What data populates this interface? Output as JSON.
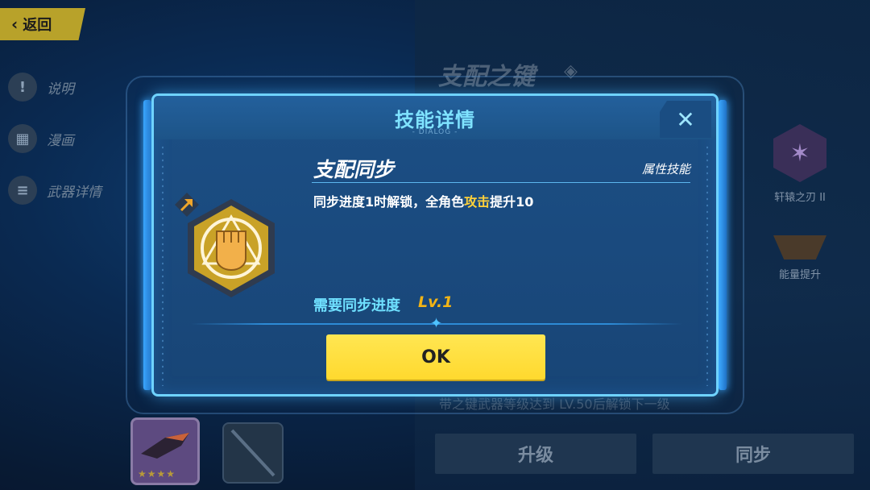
{
  "background": {
    "back_label": "返回",
    "side_menu": [
      {
        "label": "说明",
        "icon": "exclamation-icon"
      },
      {
        "label": "漫画",
        "icon": "comic-icon"
      },
      {
        "label": "武器详情",
        "icon": "document-icon"
      }
    ],
    "weapon_title": "支配之键",
    "skills": [
      {
        "name": "轩辕之刃 II"
      },
      {
        "name": "能量提升"
      }
    ],
    "hint": "带之键武器等级达到 LV.50后解锁下一级",
    "upgrade_label": "升级",
    "sync_label": "同步"
  },
  "dialog": {
    "title": "技能详情",
    "subtitle": "- DIALOG -",
    "close_icon": "close-icon",
    "skill_name": "支配同步",
    "skill_type": "属性技能",
    "desc_before": "同步进度1时解锁，全角色",
    "desc_highlight": "攻击",
    "desc_after": "提升10",
    "requirement_label": "需要同步进度",
    "requirement_level": "Lv.1",
    "ok_label": "OK"
  },
  "colors": {
    "dialog_bg": "#1c4f85",
    "dialog_border": "#6fd3ff",
    "title": "#7fe3ff",
    "highlight": "#ffd23a",
    "ok_button": "#ffd92e",
    "emblem_gold": "#c9a227"
  }
}
